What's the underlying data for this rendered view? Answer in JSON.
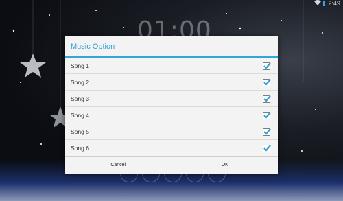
{
  "status_bar": {
    "time": "2:49"
  },
  "background": {
    "clock_text": "01:00"
  },
  "dialog": {
    "title": "Music Option",
    "items": [
      {
        "label": "Song 1",
        "checked": true
      },
      {
        "label": "Song 2",
        "checked": true
      },
      {
        "label": "Song 3",
        "checked": true
      },
      {
        "label": "Song 4",
        "checked": true
      },
      {
        "label": "Song 5",
        "checked": true
      },
      {
        "label": "Song 6",
        "checked": true
      }
    ],
    "cancel_label": "Cancel",
    "ok_label": "OK"
  },
  "colors": {
    "accent": "#33a6d8",
    "checkmark": "#2e9fd3"
  }
}
